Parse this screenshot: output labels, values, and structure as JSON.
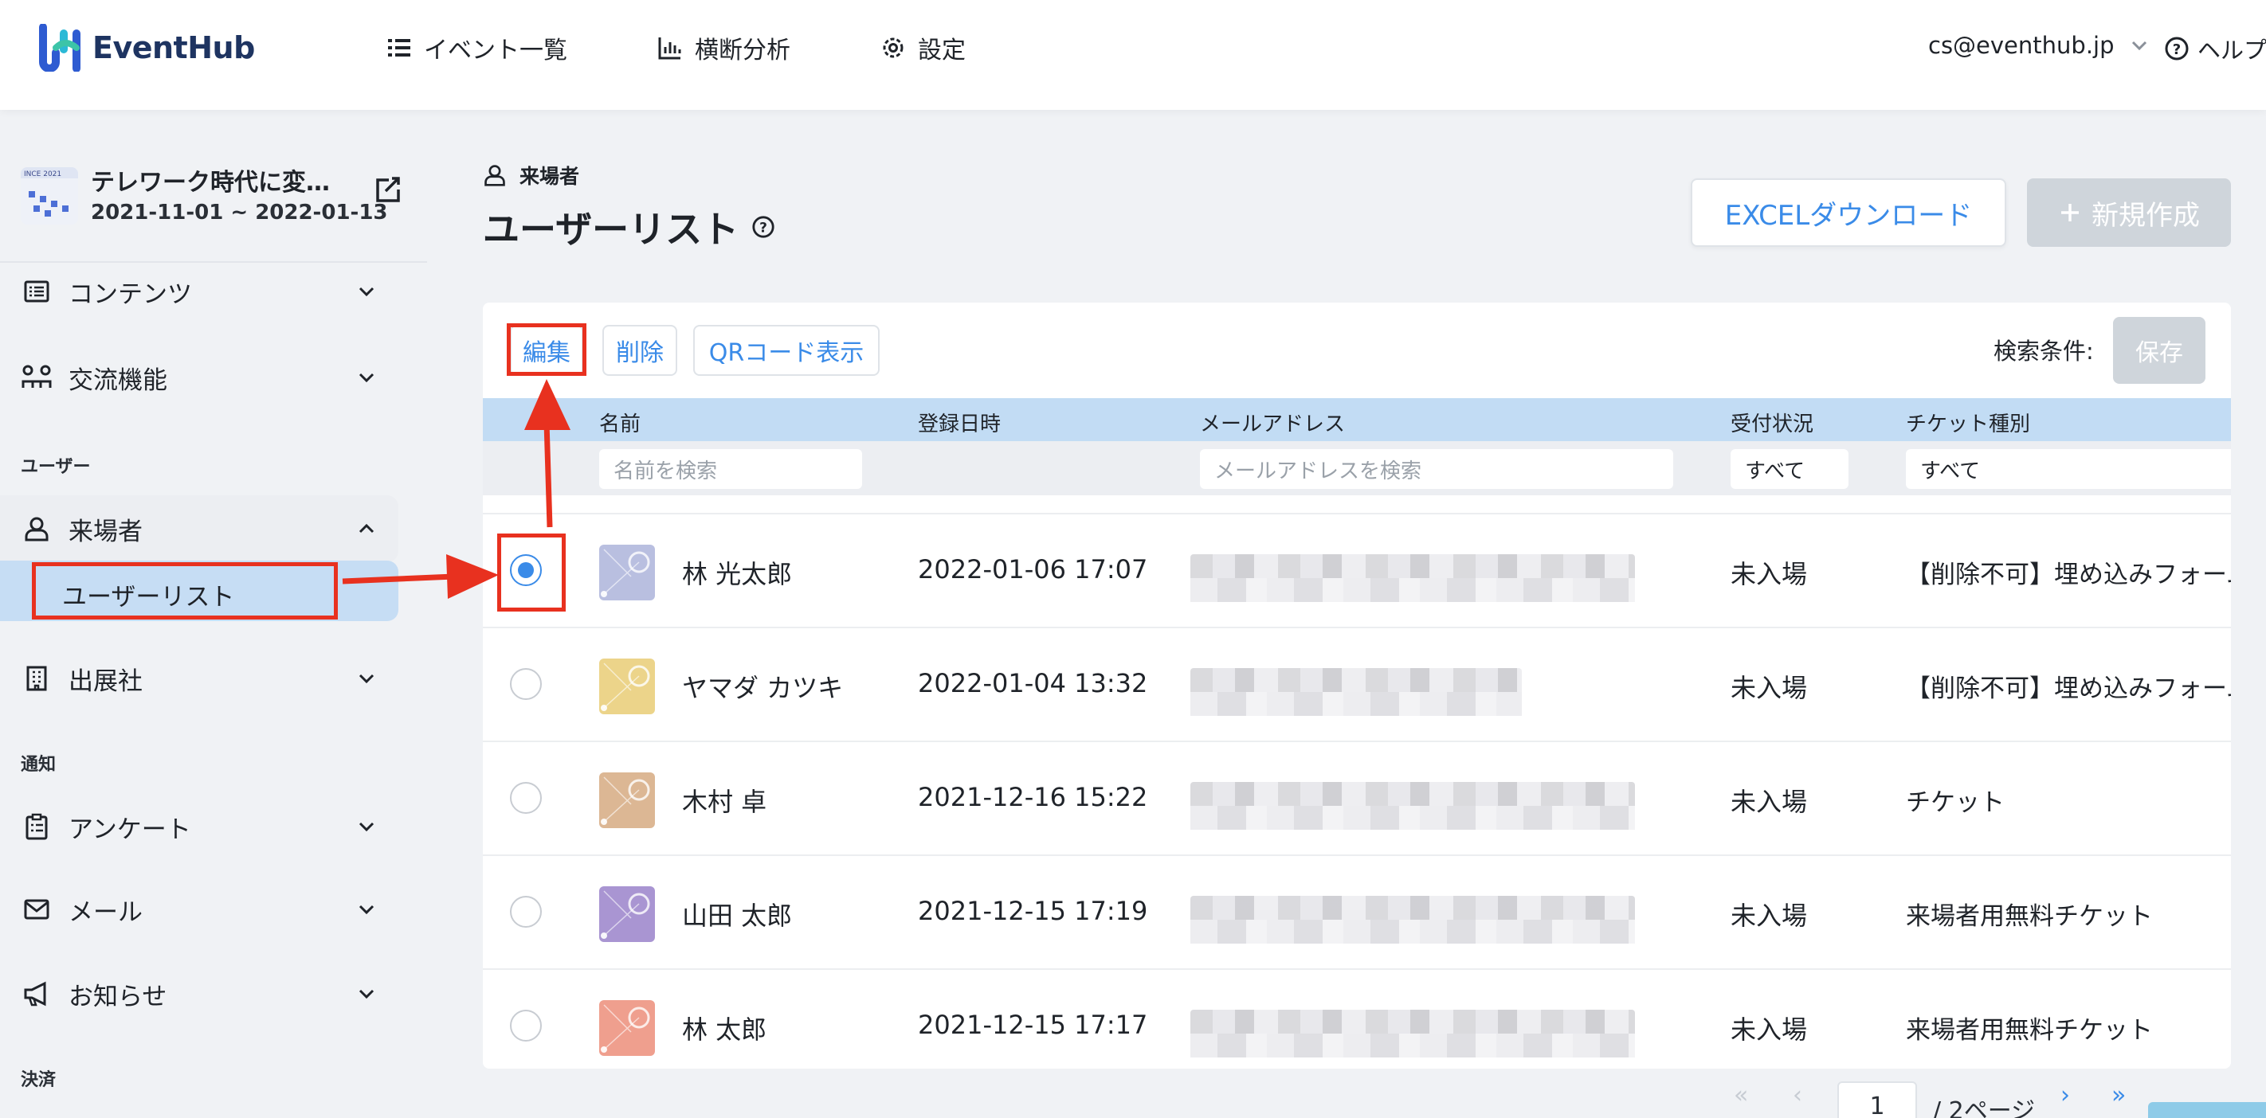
{
  "header": {
    "logo_text": "EventHub",
    "nav": [
      {
        "label": "イベント一覧",
        "icon": "list-icon"
      },
      {
        "label": "横断分析",
        "icon": "bar-chart-icon"
      },
      {
        "label": "設定",
        "icon": "gear-icon"
      }
    ],
    "account": "cs@eventhub.jp",
    "help": "ヘルプ"
  },
  "sidebar": {
    "event_title": "テレワーク時代に変…",
    "event_dates": "2021-11-01 ~ 2022-01-13",
    "thumb_text": "INCE 2021",
    "items": [
      {
        "label": "コンテンツ"
      },
      {
        "label": "交流機能"
      },
      {
        "label": "来場者"
      },
      {
        "label": "ユーザーリスト"
      },
      {
        "label": "出展社"
      },
      {
        "label": "アンケート"
      },
      {
        "label": "メール"
      },
      {
        "label": "お知らせ"
      }
    ],
    "sections": {
      "user": "ユーザー",
      "notify": "通知",
      "payment": "決済"
    }
  },
  "main": {
    "breadcrumb": "来場者",
    "title": "ユーザーリスト",
    "excel_button": "EXCELダウンロード",
    "new_button": "新規作成",
    "toolbar": {
      "edit": "編集",
      "delete": "削除",
      "qr": "QRコード表示",
      "search_cond": "検索条件:",
      "save": "保存"
    },
    "columns": {
      "name": "名前",
      "registered": "登録日時",
      "email": "メールアドレス",
      "status": "受付状況",
      "ticket": "チケット種別"
    },
    "filters": {
      "name_placeholder": "名前を検索",
      "email_placeholder": "メールアドレスを検索",
      "status_value": "すべて",
      "ticket_value": "すべて"
    },
    "rows": [
      {
        "name": "林 光太郎",
        "registered": "2022-01-06 17:07",
        "status": "未入場",
        "ticket": "【削除不可】埋め込みフォーム",
        "selected": true,
        "avatar_color": "#b9bfe0"
      },
      {
        "name": "ヤマダ カツキ",
        "registered": "2022-01-04 13:32",
        "status": "未入場",
        "ticket": "【削除不可】埋め込みフォーム",
        "selected": false,
        "avatar_color": "#ecd48a"
      },
      {
        "name": "木村 卓",
        "registered": "2021-12-16 15:22",
        "status": "未入場",
        "ticket": "チケット",
        "selected": false,
        "avatar_color": "#dcb794"
      },
      {
        "name": "山田 太郎",
        "registered": "2021-12-15 17:19",
        "status": "未入場",
        "ticket": "来場者用無料チケット",
        "selected": false,
        "avatar_color": "#a995d2"
      },
      {
        "name": "林 太郎",
        "registered": "2021-12-15 17:17",
        "status": "未入場",
        "ticket": "来場者用無料チケット",
        "selected": false,
        "avatar_color": "#ef9f8e"
      }
    ],
    "pager": {
      "page": "1",
      "total": "/ 2ページ"
    }
  },
  "colors": {
    "accent": "#3a8be8",
    "highlight": "#e8311f",
    "header_row": "#c2dcf4"
  }
}
